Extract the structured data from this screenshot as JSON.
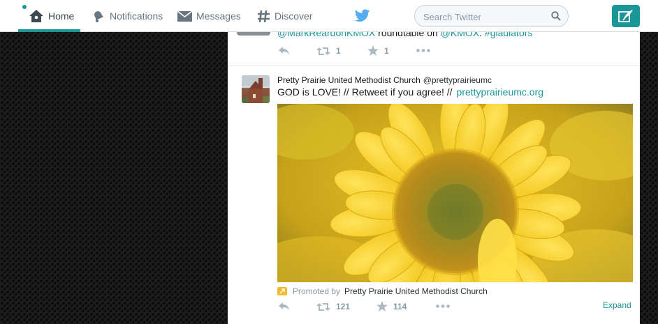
{
  "nav": {
    "home_label": "Home",
    "notifications_label": "Notifications",
    "messages_label": "Messages",
    "discover_label": "Discover",
    "accent_color": "#1a9598"
  },
  "search": {
    "placeholder": "Search Twitter"
  },
  "icons": {
    "home": "home-icon",
    "notifications": "bell-icon",
    "messages": "envelope-icon",
    "discover": "hashtag-icon",
    "logo": "twitter-bird-icon",
    "search": "magnifier-icon",
    "compose": "quill-icon",
    "reply": "reply-arrow-icon",
    "retweet": "retweet-icon",
    "favorite": "star-icon",
    "more": "ellipsis-icon",
    "promoted": "promoted-arrow-icon"
  },
  "prev_tweet": {
    "mention": "@MarkReardonKMOX",
    "middle_text": " roundtable on ",
    "mention2": "@KMOX",
    "end_text": ". ",
    "hashtag": "#gladiators",
    "retweets": "1",
    "favorites": "1"
  },
  "tweet": {
    "name": "Pretty Prairie United Methodist Church",
    "handle": "@prettyprairieumc",
    "text": "GOD is LOVE! // Retweet if you agree! //",
    "link": "prettyprairieumc.org",
    "promoted_label": "Promoted by",
    "promoted_by": "Pretty Prairie United Methodist Church",
    "retweets": "121",
    "favorites": "114",
    "expand_label": "Expand"
  }
}
